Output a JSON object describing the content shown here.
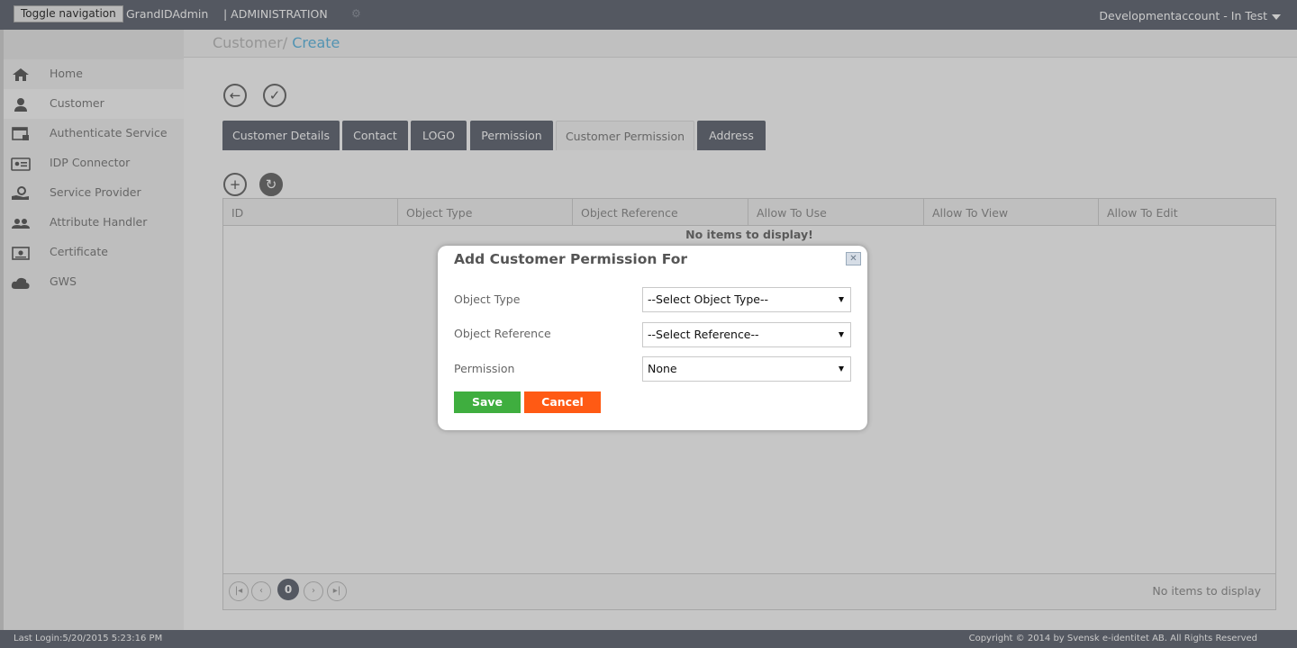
{
  "topbar": {
    "toggle_label": "Toggle navigation",
    "brand": "GrandIDAdmin",
    "section": "| ADMINISTRATION",
    "account": "Developmentaccount - In Test"
  },
  "breadcrumb": {
    "parent": "Customer/",
    "current": "Create"
  },
  "sidebar": {
    "items": [
      {
        "label": "Home",
        "icon": "home-icon"
      },
      {
        "label": "Customer",
        "icon": "user-icon"
      },
      {
        "label": "Authenticate Service",
        "icon": "window-lock-icon"
      },
      {
        "label": "IDP Connector",
        "icon": "id-card-icon"
      },
      {
        "label": "Service Provider",
        "icon": "service-hand-icon"
      },
      {
        "label": "Attribute Handler",
        "icon": "users-icon"
      },
      {
        "label": "Certificate",
        "icon": "certificate-icon"
      },
      {
        "label": "GWS",
        "icon": "cloud-gws-icon"
      }
    ]
  },
  "tabs": [
    {
      "label": "Customer Details"
    },
    {
      "label": "Contact"
    },
    {
      "label": "LOGO"
    },
    {
      "label": "Permission"
    },
    {
      "label": "Customer Permission"
    },
    {
      "label": "Address"
    }
  ],
  "grid": {
    "columns": [
      "ID",
      "Object Type",
      "Object Reference",
      "Allow To Use",
      "Allow To View",
      "Allow To Edit"
    ],
    "empty_message": "No items to display!",
    "pager_page": "0",
    "pager_info": "No items to display"
  },
  "modal": {
    "title": "Add Customer Permission For",
    "object_type_label": "Object Type",
    "object_type_value": "--Select Object Type--",
    "object_reference_label": "Object Reference",
    "object_reference_value": "--Select Reference--",
    "permission_label": "Permission",
    "permission_value": "None",
    "save_label": "Save",
    "cancel_label": "Cancel"
  },
  "footer": {
    "last_login": "Last Login:5/20/2015 5:23:16 PM",
    "copyright": "Copyright © 2014 by Svensk e-identitet AB. All Rights Reserved"
  },
  "colors": {
    "topbar": "#5d6370",
    "save": "#3fae3f",
    "cancel": "#ff5a14",
    "link": "#5bb5e0"
  }
}
